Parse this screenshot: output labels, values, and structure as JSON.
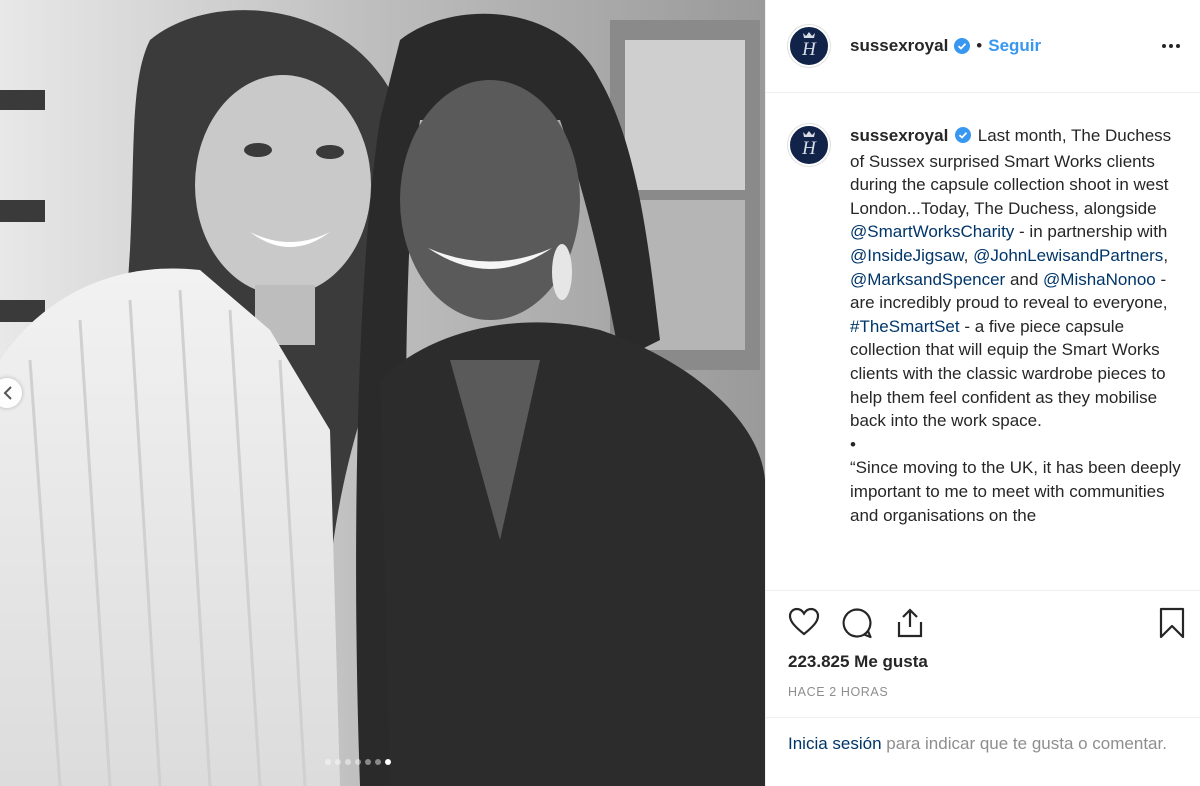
{
  "post": {
    "username": "sussexroyal",
    "follow_label": "Seguir",
    "separator": "•",
    "caption": {
      "p1": "Last month, The Duchess of Sussex surprised Smart Works clients during the capsule collection shoot in west London...Today, The Duchess, alongside ",
      "m1": "@SmartWorksCharity",
      "p2": " - in partnership with ",
      "m2": "@InsideJigsaw",
      "p3": ", ",
      "m3": "@JohnLewisandPartners",
      "p4": ", ",
      "m4": "@MarksandSpencer",
      "p5": " and ",
      "m5": "@MishaNonoo",
      "p6": " - are incredibly proud to reveal to everyone, ",
      "h1": "#TheSmartSet",
      "p7": " - a five piece capsule collection that will equip the Smart Works clients with the classic wardrobe pieces to help them feel confident as they mobilise back into the work space.",
      "bullet": "•",
      "p8": "“Since moving to the UK, it has been deeply important to me to meet with communities and organisations on the"
    },
    "likes_text": "223.825 Me gusta",
    "time_text": "HACE 2 HORAS",
    "login_link": "Inicia sesión",
    "login_rest": " para indicar que te gusta o comentar."
  },
  "carousel": {
    "total": 7,
    "active": 7
  },
  "icons": {
    "avatar": "monogram-h-icon",
    "verified": "verified-badge-icon",
    "more": "more-options-icon",
    "like": "heart-icon",
    "comment": "comment-icon",
    "share": "share-icon",
    "save": "bookmark-icon",
    "prev": "chevron-left-icon"
  },
  "colors": {
    "accent": "#3897f0",
    "link": "#003569",
    "muted": "#8e8e8e",
    "text": "#262626",
    "avatar_bg": "#12234a"
  }
}
